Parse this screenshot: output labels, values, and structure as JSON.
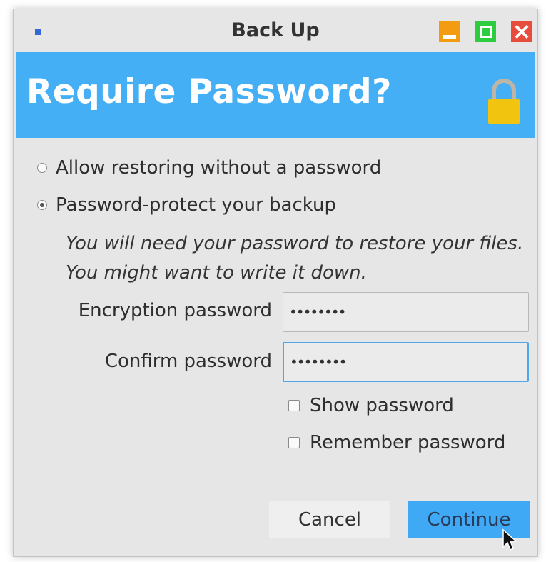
{
  "window": {
    "title": "Back Up",
    "controls": [
      "minimize-icon",
      "maximize-icon",
      "close-icon"
    ],
    "colors": {
      "minimize": "#f39c12",
      "maximize": "#2ecc40",
      "close": "#e74c3c",
      "banner": "#45aff5",
      "accent_button": "#3fa9f5",
      "lock": "#f1c40f"
    }
  },
  "banner": {
    "title": "Require Password?",
    "icon": "lock-icon"
  },
  "options": [
    {
      "label": "Allow restoring without a password",
      "selected": false
    },
    {
      "label": "Password-protect your backup",
      "selected": true
    }
  ],
  "hint": "You will need your password to restore your files. You might want to write it down.",
  "fields": {
    "encryption": {
      "label": "Encryption password",
      "value": "••••••••"
    },
    "confirm": {
      "label": "Confirm password",
      "value": "••••••••"
    }
  },
  "checkboxes": {
    "show_password": {
      "label": "Show password",
      "checked": false
    },
    "remember_password": {
      "label": "Remember password",
      "checked": false
    }
  },
  "buttons": {
    "cancel": "Cancel",
    "continue": "Continue"
  }
}
